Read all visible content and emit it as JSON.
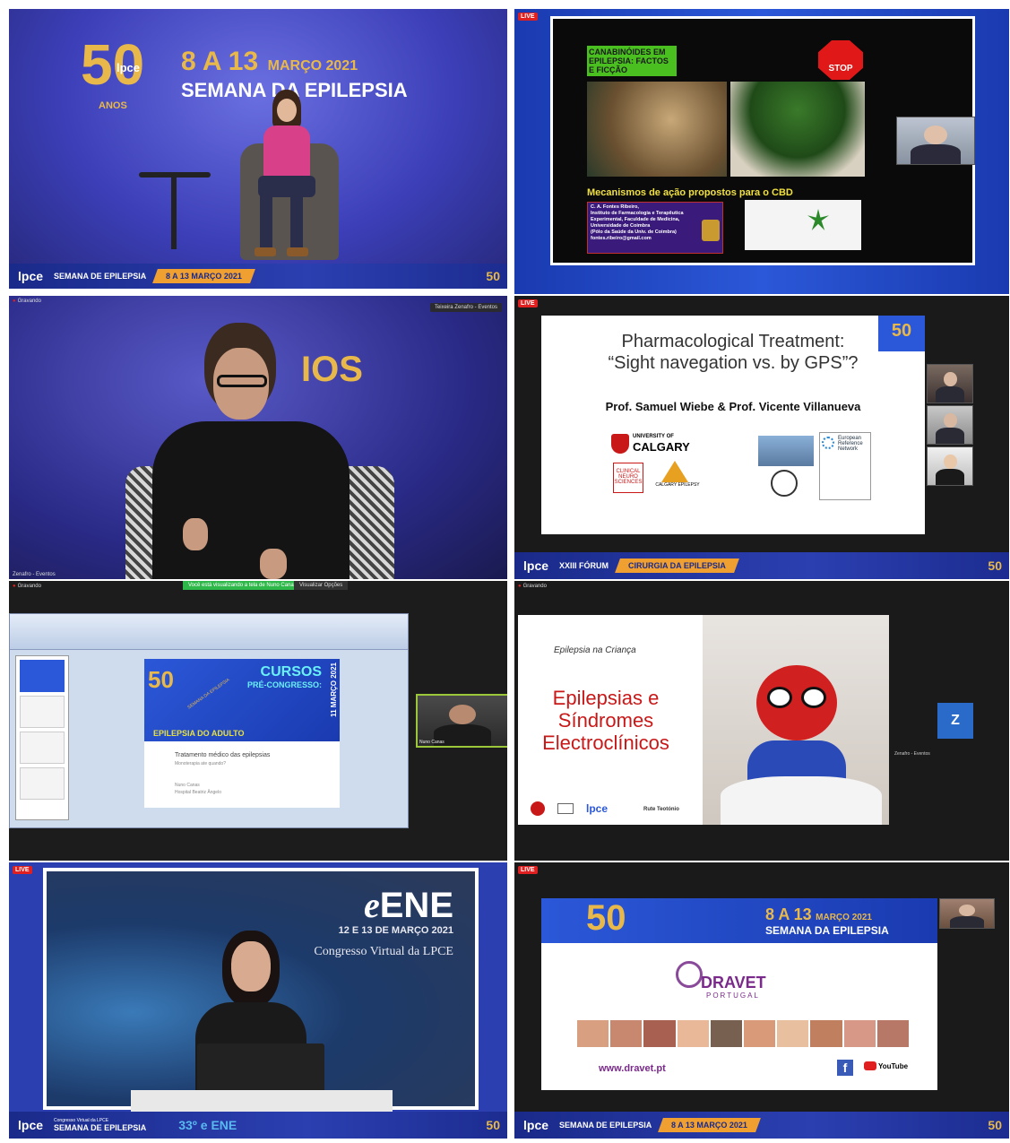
{
  "tile1": {
    "logo_text": "lpce",
    "anos": "ANOS",
    "title_dates": "8 A 13",
    "title_month": "MARÇO 2021",
    "title_line2": "SEMANA DA EPILEPSIA",
    "bar_lpce": "lpce",
    "bar_text": "SEMANA DE EPILEPSIA",
    "bar_dates": "8 A 13 MARÇO 2021"
  },
  "tile2": {
    "live": "LIVE",
    "slide_title": "CANABINÓIDES EM EPILEPSIA: FACTOS E FICÇÃO",
    "stop": "STOP",
    "mechanisms": "Mecanismos de ação propostos para o CBD",
    "author_lines": [
      "C. A. Fontes Ribeiro,",
      "Instituto de Farmacologia e Terapêutica",
      "Experimental, Faculdade de Medicina,",
      "Universidade de Coimbra",
      "(Pólo da Saúde da Univ. de Coimbra)",
      "fontes.ribeiro@gmail.com"
    ]
  },
  "tile3": {
    "rec": "Gravando",
    "name_tag": "Teixeira Zenafro - Eventos",
    "bg_text": "IOS",
    "bottom_name": "Zenafro - Eventos"
  },
  "tile4": {
    "live": "LIVE",
    "slide_line1": "Pharmacological Treatment:",
    "slide_line2": "“Sight navegation vs. by GPS”?",
    "speakers": "Prof. Samuel Wiebe & Prof. Vicente Villanueva",
    "univ_of": "UNIVERSITY OF",
    "calgary": "CALGARY",
    "neuro": "CLINICAL NEURO SCIENCES",
    "calgary_epilepsy": "CALGARY EPILEPSY",
    "ern_lines": [
      "European",
      "Reference",
      "Network"
    ],
    "bar_lpce": "lpce",
    "bar_text": "XXIII FÓRUM",
    "bar_gold": "CIRURGIA DA EPILEPSIA"
  },
  "tile5": {
    "rec": "Gravando",
    "green_notice": "Você está visualizando a tela de Nuno Canas",
    "view_options": "Visualizar Opções",
    "cursos": "CURSOS",
    "pre_congresso": "PRÉ-CONGRESSO:",
    "adulto": "EPILEPSIA DO ADULTO",
    "date_vertical": "11 MARÇO 2021",
    "semana": "SEMANA DA EPILEPSIA",
    "tratamento": "Tratamento médico das epilepsias",
    "monoterapia": "Monoterapia ate quando?",
    "presenter": "Nuno Canas",
    "hospital": "Hospital Beatriz Ângelo",
    "cam_name": "Nuno Canas"
  },
  "tile6": {
    "rec": "Gravando",
    "slide_sub": "Epilepsia na Criança",
    "slide_title_lines": [
      "Epilepsias e",
      "Síndromes",
      "Electroclínicos"
    ],
    "author": "Rute Teotónio",
    "avatar_letter": "Z",
    "avatar_name": "Zenafro - Eventos"
  },
  "tile7": {
    "live": "LIVE",
    "ene": "ENE",
    "ene_e": "e",
    "dates": "12 E 13 DE MARÇO 2021",
    "congresso": "Congresso Virtual da LPCE",
    "bar_lpce": "lpce",
    "bar_small": "Congresso Virtual da LPCE",
    "bar_text": "SEMANA DE EPILEPSIA",
    "bar_ene": "33º e ENE"
  },
  "tile8": {
    "live": "LIVE",
    "dates": "8 A 13",
    "month": "MARÇO 2021",
    "semana": "SEMANA DA EPILEPSIA",
    "dravet": "DRAVET",
    "portugal": "PORTUGAL",
    "url": "www.dravet.pt",
    "youtube": "YouTube",
    "bar_lpce": "lpce",
    "bar_text": "SEMANA DE EPILEPSIA",
    "bar_dates": "8 A 13 MARÇO 2021"
  },
  "colors": {
    "accent_blue": "#2b3fb0",
    "gold": "#e8b84a",
    "orange": "#f0a030",
    "live_red": "#e02020"
  }
}
